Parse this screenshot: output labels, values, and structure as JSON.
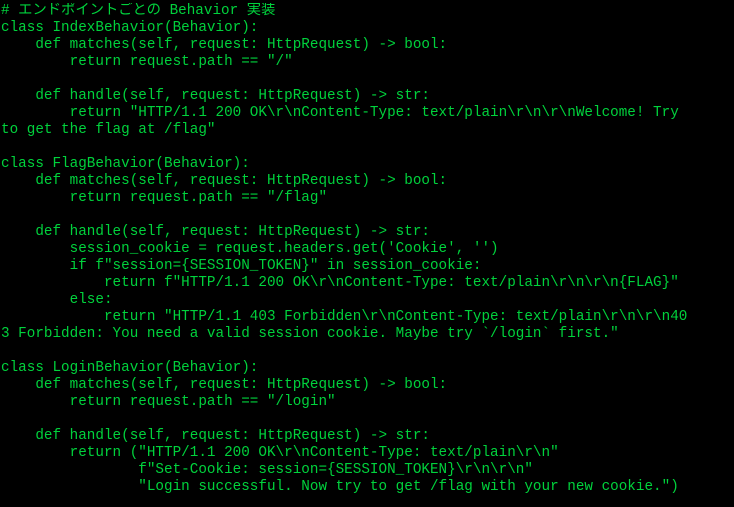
{
  "theme": {
    "background": "#000000",
    "foreground": "#00d23c"
  },
  "code_lines": [
    {
      "text": "# エンドポイントごとの Behavior 実装",
      "kind": "comment"
    },
    {
      "text": "class IndexBehavior(Behavior):",
      "kind": "code"
    },
    {
      "text": "    def matches(self, request: HttpRequest) -> bool:",
      "kind": "code"
    },
    {
      "text": "        return request.path == \"/\"",
      "kind": "code"
    },
    {
      "text": "",
      "kind": "blank"
    },
    {
      "text": "    def handle(self, request: HttpRequest) -> str:",
      "kind": "code"
    },
    {
      "text": "        return \"HTTP/1.1 200 OK\\r\\nContent-Type: text/plain\\r\\n\\r\\nWelcome! Try",
      "kind": "code"
    },
    {
      "text": "to get the flag at /flag\"",
      "kind": "code"
    },
    {
      "text": "",
      "kind": "blank"
    },
    {
      "text": "class FlagBehavior(Behavior):",
      "kind": "code"
    },
    {
      "text": "    def matches(self, request: HttpRequest) -> bool:",
      "kind": "code"
    },
    {
      "text": "        return request.path == \"/flag\"",
      "kind": "code"
    },
    {
      "text": "",
      "kind": "blank"
    },
    {
      "text": "    def handle(self, request: HttpRequest) -> str:",
      "kind": "code"
    },
    {
      "text": "        session_cookie = request.headers.get('Cookie', '')",
      "kind": "code"
    },
    {
      "text": "        if f\"session={SESSION_TOKEN}\" in session_cookie:",
      "kind": "code"
    },
    {
      "text": "            return f\"HTTP/1.1 200 OK\\r\\nContent-Type: text/plain\\r\\n\\r\\n{FLAG}\"",
      "kind": "code"
    },
    {
      "text": "        else:",
      "kind": "code"
    },
    {
      "text": "            return \"HTTP/1.1 403 Forbidden\\r\\nContent-Type: text/plain\\r\\n\\r\\n40",
      "kind": "code"
    },
    {
      "text": "3 Forbidden: You need a valid session cookie. Maybe try `/login` first.\"",
      "kind": "code"
    },
    {
      "text": "",
      "kind": "blank"
    },
    {
      "text": "class LoginBehavior(Behavior):",
      "kind": "code"
    },
    {
      "text": "    def matches(self, request: HttpRequest) -> bool:",
      "kind": "code"
    },
    {
      "text": "        return request.path == \"/login\"",
      "kind": "code"
    },
    {
      "text": "",
      "kind": "blank"
    },
    {
      "text": "    def handle(self, request: HttpRequest) -> str:",
      "kind": "code"
    },
    {
      "text": "        return (\"HTTP/1.1 200 OK\\r\\nContent-Type: text/plain\\r\\n\"",
      "kind": "code"
    },
    {
      "text": "                f\"Set-Cookie: session={SESSION_TOKEN}\\r\\n\\r\\n\"",
      "kind": "code"
    },
    {
      "text": "                \"Login successful. Now try to get /flag with your new cookie.\")",
      "kind": "code"
    }
  ]
}
